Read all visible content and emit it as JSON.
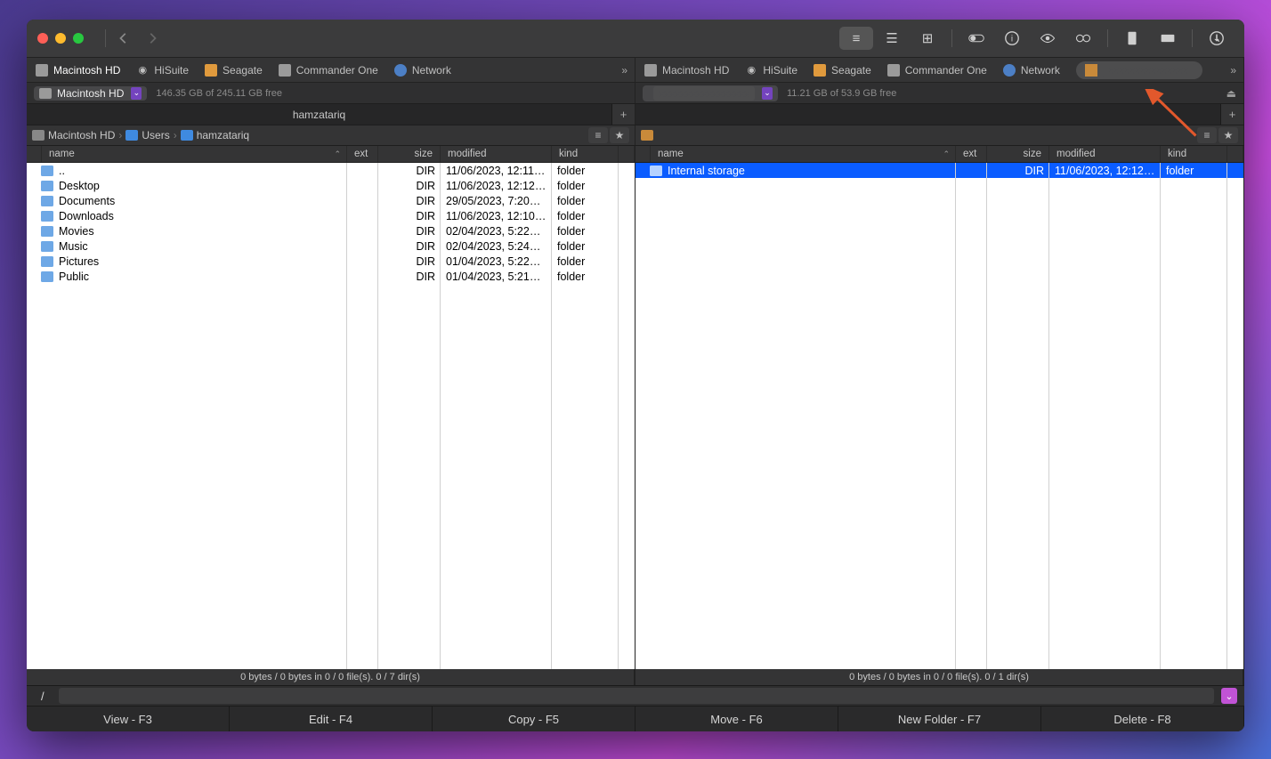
{
  "locations": {
    "mac": "Macintosh HD",
    "hisuite": "HiSuite",
    "seagate": "Seagate",
    "commander": "Commander One",
    "network": "Network"
  },
  "left": {
    "drive_label": "Macintosh HD",
    "drive_info": "146.35 GB of 245.11 GB free",
    "tab": "hamzatariq",
    "crumbs": {
      "c0": "Macintosh HD",
      "c1": "Users",
      "c2": "hamzatariq"
    },
    "status": "0 bytes / 0 bytes in 0 / 0 file(s). 0 / 7 dir(s)",
    "files": [
      {
        "name": "..",
        "size": "DIR",
        "mod": "11/06/2023, 12:11…",
        "kind": "folder"
      },
      {
        "name": "Desktop",
        "size": "DIR",
        "mod": "11/06/2023, 12:12…",
        "kind": "folder"
      },
      {
        "name": "Documents",
        "size": "DIR",
        "mod": "29/05/2023, 7:20…",
        "kind": "folder"
      },
      {
        "name": "Downloads",
        "size": "DIR",
        "mod": "11/06/2023, 12:10…",
        "kind": "folder"
      },
      {
        "name": "Movies",
        "size": "DIR",
        "mod": "02/04/2023, 5:22…",
        "kind": "folder"
      },
      {
        "name": "Music",
        "size": "DIR",
        "mod": "02/04/2023, 5:24…",
        "kind": "folder"
      },
      {
        "name": "Pictures",
        "size": "DIR",
        "mod": "01/04/2023, 5:22…",
        "kind": "folder"
      },
      {
        "name": "Public",
        "size": "DIR",
        "mod": "01/04/2023, 5:21…",
        "kind": "folder"
      }
    ]
  },
  "right": {
    "drive_info": "11.21 GB of 53.9 GB free",
    "status": "0 bytes / 0 bytes in 0 / 0 file(s). 0 / 1 dir(s)",
    "files": [
      {
        "name": "Internal storage",
        "size": "DIR",
        "mod": "11/06/2023, 12:12…",
        "kind": "folder"
      }
    ]
  },
  "columns": {
    "name": "name",
    "ext": "ext",
    "size": "size",
    "mod": "modified",
    "kind": "kind"
  },
  "cmd_prefix": "/",
  "footer": {
    "view": "View - F3",
    "edit": "Edit - F4",
    "copy": "Copy - F5",
    "move": "Move - F6",
    "newf": "New Folder - F7",
    "del": "Delete - F8"
  }
}
